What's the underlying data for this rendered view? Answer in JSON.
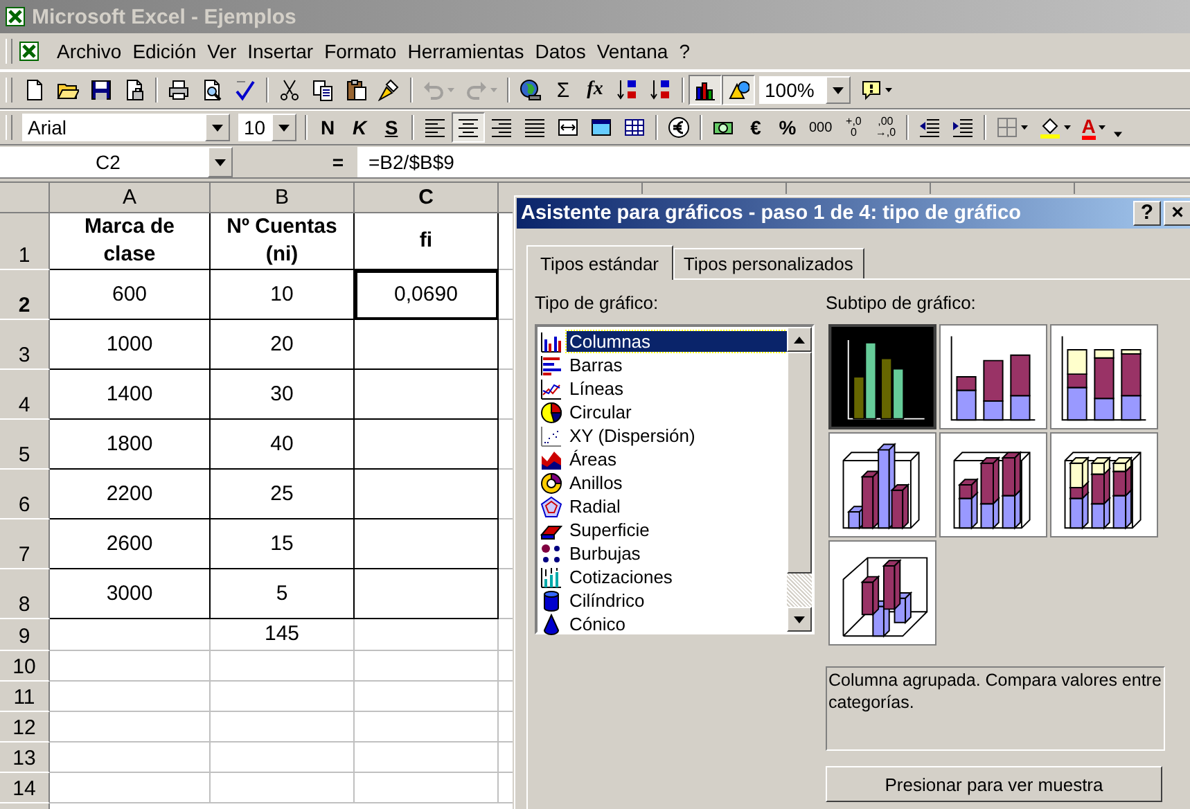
{
  "window": {
    "title": "Microsoft Excel - Ejemplos"
  },
  "menu": [
    "Archivo",
    "Edición",
    "Ver",
    "Insertar",
    "Formato",
    "Herramientas",
    "Datos",
    "Ventana",
    "?"
  ],
  "standard_toolbar": [
    {
      "kind": "icon",
      "pressed": false,
      "disabled": false,
      "dropdown": false
    },
    {
      "kind": "icon",
      "pressed": false,
      "disabled": false,
      "dropdown": false
    },
    {
      "kind": "icon",
      "pressed": false,
      "disabled": false,
      "dropdown": false
    },
    {
      "kind": "icon",
      "pressed": false,
      "disabled": false,
      "dropdown": false
    },
    {
      "kind": "separator"
    },
    {
      "kind": "icon",
      "pressed": false,
      "disabled": false,
      "dropdown": false
    },
    {
      "kind": "icon",
      "pressed": false,
      "disabled": false,
      "dropdown": false
    },
    {
      "kind": "icon",
      "pressed": false,
      "disabled": false,
      "dropdown": false
    },
    {
      "kind": "separator"
    },
    {
      "kind": "icon",
      "pressed": false,
      "disabled": false,
      "dropdown": false
    },
    {
      "kind": "icon",
      "pressed": false,
      "disabled": false,
      "dropdown": false
    },
    {
      "kind": "icon",
      "pressed": false,
      "disabled": false,
      "dropdown": false
    },
    {
      "kind": "icon",
      "pressed": false,
      "disabled": false,
      "dropdown": false
    },
    {
      "kind": "separator"
    },
    {
      "kind": "icon",
      "pressed": false,
      "disabled": true,
      "dropdown": true
    },
    {
      "kind": "icon",
      "pressed": false,
      "disabled": true,
      "dropdown": true
    },
    {
      "kind": "separator"
    },
    {
      "kind": "icon",
      "pressed": false,
      "disabled": false,
      "dropdown": false
    },
    {
      "kind": "text",
      "label": "Σ",
      "pressed": false,
      "disabled": false,
      "dropdown": false
    },
    {
      "kind": "text",
      "label": "fx",
      "pressed": false,
      "disabled": false,
      "dropdown": false
    },
    {
      "kind": "icon",
      "pressed": false,
      "disabled": false,
      "dropdown": false
    },
    {
      "kind": "icon",
      "pressed": false,
      "disabled": false,
      "dropdown": false
    },
    {
      "kind": "separator"
    },
    {
      "kind": "icon",
      "pressed": true,
      "disabled": false,
      "dropdown": false
    },
    {
      "kind": "icon",
      "pressed": true,
      "disabled": false,
      "dropdown": false
    },
    {
      "kind": "combo",
      "value": "100%"
    },
    {
      "kind": "icon",
      "pressed": false,
      "disabled": false,
      "dropdown": true
    }
  ],
  "formatting_toolbar": [
    {
      "kind": "combo",
      "value": "Arial"
    },
    {
      "kind": "combo",
      "value": "10"
    },
    {
      "kind": "separator"
    },
    {
      "kind": "text",
      "label": "N",
      "pressed": false,
      "disabled": false,
      "dropdown": false
    },
    {
      "kind": "text",
      "label": "K",
      "pressed": false,
      "disabled": false,
      "dropdown": false
    },
    {
      "kind": "text",
      "label": "S",
      "pressed": false,
      "disabled": false,
      "dropdown": false
    },
    {
      "kind": "separator"
    },
    {
      "kind": "icon",
      "pressed": false,
      "disabled": false,
      "dropdown": false
    },
    {
      "kind": "icon",
      "pressed": true,
      "disabled": false,
      "dropdown": false
    },
    {
      "kind": "icon",
      "pressed": false,
      "disabled": false,
      "dropdown": false
    },
    {
      "kind": "icon",
      "pressed": false,
      "disabled": false,
      "dropdown": false
    },
    {
      "kind": "icon",
      "pressed": false,
      "disabled": false,
      "dropdown": false
    },
    {
      "kind": "icon",
      "pressed": false,
      "disabled": false,
      "dropdown": false
    },
    {
      "kind": "icon",
      "pressed": false,
      "disabled": false,
      "dropdown": false
    },
    {
      "kind": "separator"
    },
    {
      "kind": "icon",
      "pressed": false,
      "disabled": false,
      "dropdown": false
    },
    {
      "kind": "separator"
    },
    {
      "kind": "icon",
      "pressed": false,
      "disabled": false,
      "dropdown": false
    },
    {
      "kind": "text",
      "label": "€",
      "pressed": false,
      "disabled": false,
      "dropdown": false
    },
    {
      "kind": "text",
      "label": "%",
      "pressed": false,
      "disabled": false,
      "dropdown": false
    },
    {
      "kind": "text",
      "label": "000",
      "pressed": false,
      "disabled": false,
      "dropdown": false
    },
    {
      "kind": "decimal",
      "lines": [
        "+,0",
        "0"
      ],
      "pressed": false,
      "disabled": false,
      "dropdown": false
    },
    {
      "kind": "decimal",
      "lines": [
        ",00",
        "→,0"
      ],
      "pressed": false,
      "disabled": false,
      "dropdown": false
    },
    {
      "kind": "separator"
    },
    {
      "kind": "icon",
      "pressed": false,
      "disabled": false,
      "dropdown": false
    },
    {
      "kind": "icon",
      "pressed": false,
      "disabled": false,
      "dropdown": false
    },
    {
      "kind": "separator"
    },
    {
      "kind": "icon",
      "pressed": false,
      "disabled": false,
      "dropdown": true
    },
    {
      "kind": "icon",
      "pressed": false,
      "disabled": false,
      "dropdown": true
    },
    {
      "kind": "color_text",
      "label": "A",
      "pressed": false,
      "disabled": false,
      "dropdown": true
    }
  ],
  "formula_bar": {
    "name_box": "C2",
    "equals": "=",
    "formula": "=B2/$B$9"
  },
  "columns": [
    {
      "label": "A",
      "selected": false
    },
    {
      "label": "B",
      "selected": false
    },
    {
      "label": "C",
      "selected": true
    }
  ],
  "rows": [
    {
      "header": "1",
      "kind": "header",
      "selected": false,
      "cells": [
        "Marca de clase",
        "Nº Cuentas (ni)",
        "fi"
      ]
    },
    {
      "header": "2",
      "kind": "data",
      "selected": true,
      "cells": [
        "600",
        "10",
        "0,0690"
      ]
    },
    {
      "header": "3",
      "kind": "data",
      "selected": false,
      "cells": [
        "1000",
        "20"
      ]
    },
    {
      "header": "4",
      "kind": "data",
      "selected": false,
      "cells": [
        "1400",
        "30"
      ]
    },
    {
      "header": "5",
      "kind": "data",
      "selected": false,
      "cells": [
        "1800",
        "40"
      ]
    },
    {
      "header": "6",
      "kind": "data",
      "selected": false,
      "cells": [
        "2200",
        "25"
      ]
    },
    {
      "header": "7",
      "kind": "data",
      "selected": false,
      "cells": [
        "2600",
        "15"
      ]
    },
    {
      "header": "8",
      "kind": "data",
      "selected": false,
      "cells": [
        "3000",
        "5"
      ]
    },
    {
      "header": "9",
      "kind": "total",
      "selected": false,
      "cells": [
        null,
        "145"
      ]
    },
    {
      "header": "10",
      "kind": "empty",
      "selected": false
    },
    {
      "header": "11",
      "kind": "empty",
      "selected": false
    },
    {
      "header": "12",
      "kind": "empty",
      "selected": false
    },
    {
      "header": "13",
      "kind": "empty",
      "selected": false
    },
    {
      "header": "14",
      "kind": "empty",
      "selected": false
    }
  ],
  "dialog": {
    "title": "Asistente para gráficos - paso 1 de 4: tipo de gráfico",
    "help_button": "?",
    "close_button": "×",
    "tabs": [
      {
        "label": "Tipos estándar",
        "selected": true
      },
      {
        "label": "Tipos personalizados",
        "selected": false
      }
    ],
    "chart_type_label": "Tipo de gráfico:",
    "chart_types": [
      {
        "label": "Columnas",
        "selected": true
      },
      {
        "label": "Barras",
        "selected": false
      },
      {
        "label": "Líneas",
        "selected": false
      },
      {
        "label": "Circular",
        "selected": false
      },
      {
        "label": "XY (Dispersión)",
        "selected": false
      },
      {
        "label": "Áreas",
        "selected": false
      },
      {
        "label": "Anillos",
        "selected": false
      },
      {
        "label": "Radial",
        "selected": false
      },
      {
        "label": "Superficie",
        "selected": false
      },
      {
        "label": "Burbujas",
        "selected": false
      },
      {
        "label": "Cotizaciones",
        "selected": false
      },
      {
        "label": "Cilíndrico",
        "selected": false
      },
      {
        "label": "Cónico",
        "selected": false
      }
    ],
    "subtype_label": "Subtipo de gráfico:",
    "subtypes": [
      {
        "kind": "clustered",
        "selected": true
      },
      {
        "kind": "stacked",
        "selected": false
      },
      {
        "kind": "stacked100",
        "selected": false
      },
      {
        "kind": "clustered3d",
        "selected": false
      },
      {
        "kind": "stacked3d",
        "selected": false
      },
      {
        "kind": "stacked100_3d",
        "selected": false
      },
      {
        "kind": "column3d",
        "selected": false
      }
    ],
    "description": "Columna agrupada. Compara valores entre categorías.",
    "preview_button": "Presionar para ver muestra"
  }
}
